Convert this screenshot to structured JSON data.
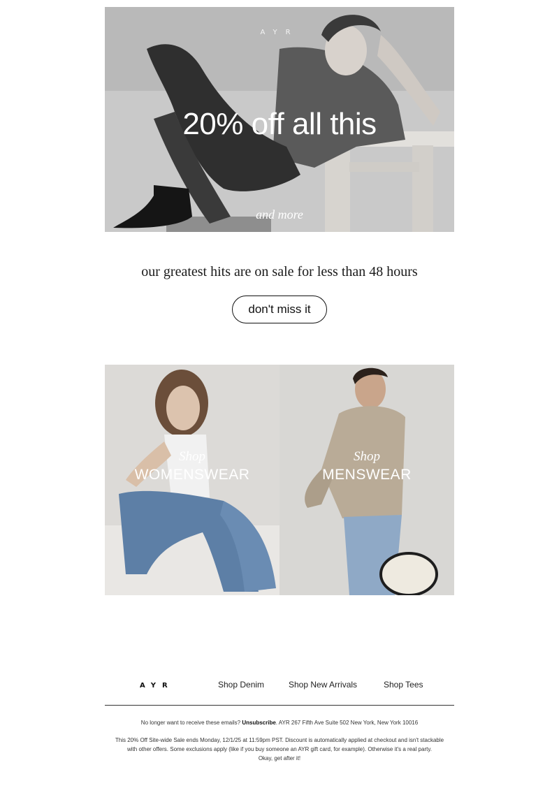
{
  "hero": {
    "logo": "AYR",
    "headline": "20% off all this",
    "subline": "and more"
  },
  "tagline": "our greatest hits are on sale for less than 48 hours",
  "cta": {
    "label": "don't miss it"
  },
  "panels": {
    "womens": {
      "shop": "Shop",
      "title": "WOMENSWEAR"
    },
    "mens": {
      "shop": "Shop",
      "title": "MENSWEAR"
    }
  },
  "footer": {
    "logo": "AYR",
    "links": [
      "Shop Denim",
      "Shop New Arrivals",
      "Shop Tees"
    ],
    "unsubscribe_prefix": "No longer want to receive these emails? ",
    "unsubscribe_label": "Unsubscribe",
    "address": ". AYR 267 Fifth Ave Suite 502 New York, New York 10016",
    "disclaimer_line1": "This 20% Off Site-wide Sale ends Monday, 12/1/25 at 11:59pm PST. Discount is automatically applied at checkout and isn't stackable",
    "disclaimer_line2": "with other offers. Some exclusions apply (like if you buy someone an AYR gift card, for example).  Otherwise it's a real party.",
    "signoff": "Okay, get after it!"
  }
}
